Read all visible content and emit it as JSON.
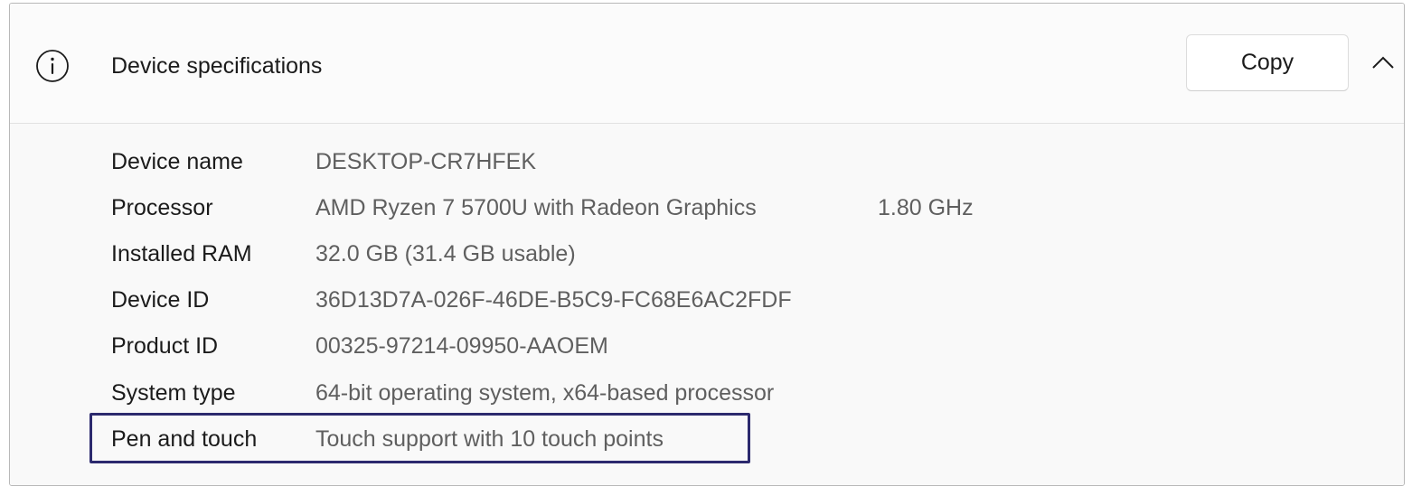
{
  "header": {
    "title": "Device specifications",
    "icon": "info-icon",
    "copy_label": "Copy",
    "collapse_icon": "chevron-up-icon"
  },
  "specs": [
    {
      "label": "Device name",
      "value": "DESKTOP-CR7HFEK",
      "extra": ""
    },
    {
      "label": "Processor",
      "value": "AMD Ryzen 7 5700U with Radeon Graphics",
      "extra": "1.80 GHz"
    },
    {
      "label": "Installed RAM",
      "value": "32.0 GB (31.4 GB usable)",
      "extra": ""
    },
    {
      "label": "Device ID",
      "value": "36D13D7A-026F-46DE-B5C9-FC68E6AC2FDF",
      "extra": ""
    },
    {
      "label": "Product ID",
      "value": "00325-97214-09950-AAOEM",
      "extra": ""
    },
    {
      "label": "System type",
      "value": "64-bit operating system, x64-based processor",
      "extra": ""
    },
    {
      "label": "Pen and touch",
      "value": "Touch support with 10 touch points",
      "extra": ""
    }
  ],
  "highlight": {
    "target": "Pen and touch",
    "color": "#2c2a6e"
  }
}
